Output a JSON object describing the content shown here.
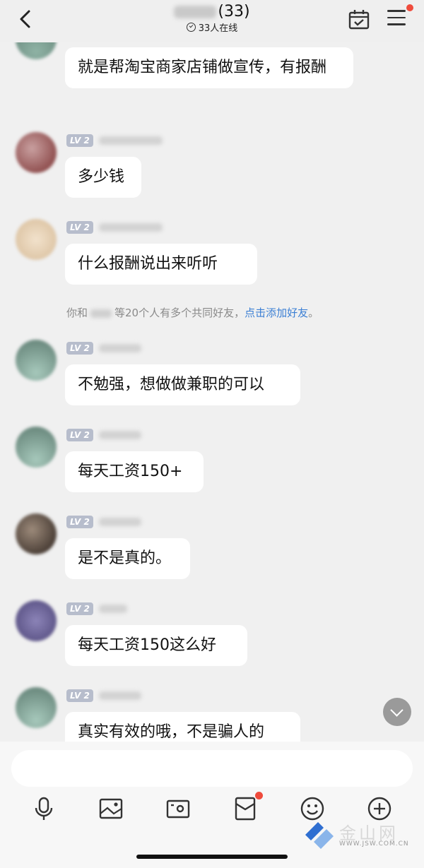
{
  "header": {
    "back_icon": "chevron-left-icon",
    "member_count": "(33)",
    "online_status": "33人在线",
    "calendar_icon": "calendar-check-icon",
    "menu_icon": "menu-icon",
    "accent_red": "#ef4b3c"
  },
  "messages": [
    {
      "level": "",
      "text": "就是帮淘宝商家店铺做宣传，有报酬"
    },
    {
      "level": "LV 2",
      "text": "多少钱"
    },
    {
      "level": "LV 2",
      "text": " 什么报酬说出来听听"
    },
    {
      "level": "LV 2",
      "text": "不勉强，想做做兼职的可以"
    },
    {
      "level": "LV 2",
      "text": "每天工资150+"
    },
    {
      "level": "LV 2",
      "text": "是不是真的。"
    },
    {
      "level": "LV 2",
      "text": "每天工资150这么好"
    },
    {
      "level": "LV 2",
      "text": "真实有效的哦，不是骗人的"
    }
  ],
  "system_notice": {
    "prefix": "你和",
    "middle": "等20个人有多个共同好友，",
    "link": "点击添加好友",
    "suffix": "。",
    "link_color": "#3b7fd4"
  },
  "toolbar": {
    "icons": [
      "microphone-icon",
      "image-icon",
      "camera-icon",
      "red-packet-icon",
      "emoji-icon",
      "add-icon"
    ]
  },
  "watermark": {
    "text": "金山网",
    "url": "WWW.JSW.COM.CN"
  }
}
